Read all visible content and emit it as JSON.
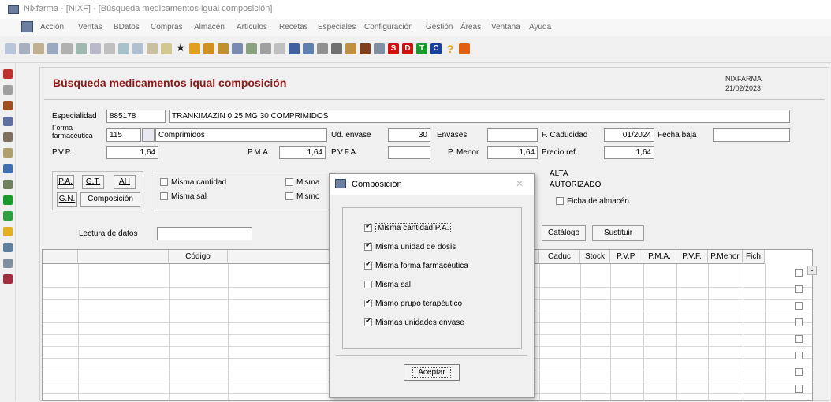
{
  "window": {
    "title": "Nixfarma - [NIXF] - [Búsqueda medicamentos igual composición]"
  },
  "menu": [
    "Acción",
    "Ventas",
    "BDatos",
    "Compras",
    "Almacén",
    "Artículos",
    "Recetas",
    "Especiales",
    "Configuración",
    "Gestión",
    "Áreas",
    "Ventana",
    "Ayuda"
  ],
  "form": {
    "title": "Búsqueda medicamentos iqual composición",
    "brand_name": "NIXFARMA",
    "brand_date": "21/02/2023",
    "especialidad_label": "Especialidad",
    "especialidad_code": "885178",
    "especialidad_name": "TRANKIMAZIN 0,25 MG 30 COMPRIMIDOS",
    "forma_label_1": "Forma",
    "forma_label_2": "farmacéutica",
    "forma_code": "115",
    "forma_name": "Comprimidos",
    "ud_envase_label": "Ud. envase",
    "ud_envase_value": "30",
    "envases_label": "Envases",
    "envases_value": "",
    "caducidad_label": "F. Caducidad",
    "caducidad_value": "01/2024",
    "fecha_baja_label": "Fecha baja",
    "fecha_baja_value": "",
    "pvp_label": "P.V.P.",
    "pvp_value": "1,64",
    "pma_label": "P.M.A.",
    "pma_value": "1,64",
    "pvfa_label": "P.V.F.A.",
    "pvfa_value": "",
    "pmenor_label": "P. Menor",
    "pmenor_value": "1,64",
    "precio_ref_label": "Precio ref.",
    "precio_ref_value": "1,64",
    "status_1": "ALTA",
    "status_2": "AUTORIZADO",
    "ficha_almacen": "Ficha de almacén",
    "btn_pa": "P.A.",
    "btn_gt": "G.T.",
    "btn_ah": "AH",
    "btn_gn": "G.N.",
    "btn_composicion": "Composición",
    "chk_misma_cantidad": "Misma cantidad",
    "chk_misma_sal": "Misma sal",
    "chk_misma_unidad_cut": "Misma",
    "chk_mismo_cut": "Mismo",
    "lectura_label": "Lectura de datos",
    "lectura_value": "",
    "btn_catalogo": "Catálogo",
    "btn_sustituir": "Sustituir"
  },
  "table": {
    "columns": [
      "",
      "",
      "Código",
      "",
      "Caduc",
      "Stock",
      "P.V.P.",
      "P.M.A.",
      "P.V.F.",
      "P.Menor",
      "Fich"
    ]
  },
  "dialog": {
    "title": "Composición",
    "options": [
      {
        "label": "Misma cantidad P.A.",
        "checked": true
      },
      {
        "label": "Misma unidad de dosis",
        "checked": true
      },
      {
        "label": "Misma forma farmacéutica",
        "checked": true
      },
      {
        "label": "Misma sal",
        "checked": false
      },
      {
        "label": "Mismo grupo terapéutico",
        "checked": true
      },
      {
        "label": "Mismas unidades envase",
        "checked": true
      }
    ],
    "accept": "Aceptar"
  },
  "colors": {
    "title_red": "#8b1a1a",
    "icon_red": "#d01010",
    "icon_green": "#1a9a2a",
    "icon_blue": "#1a3fa0"
  }
}
